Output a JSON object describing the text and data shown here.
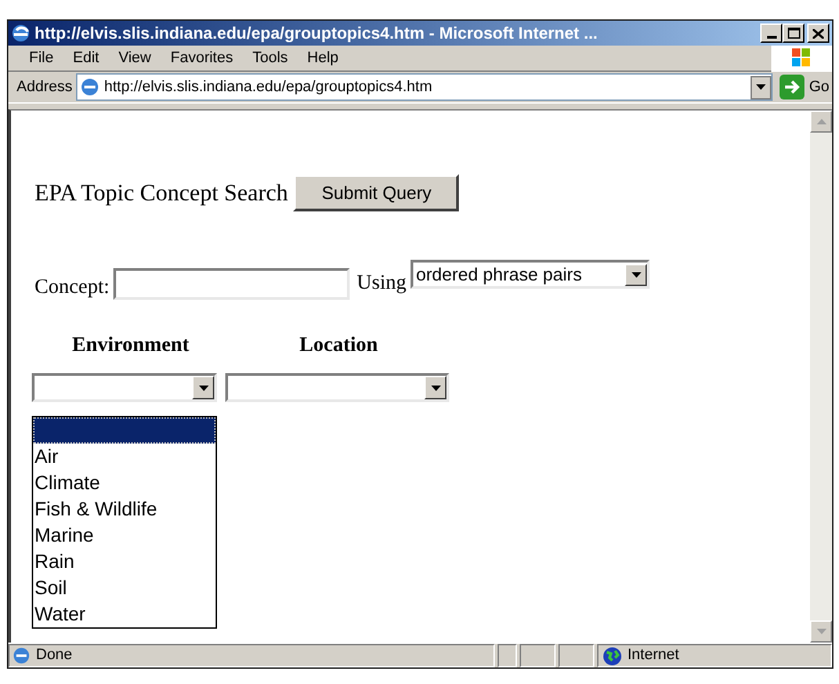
{
  "window": {
    "title": "http://elvis.slis.indiana.edu/epa/grouptopics4.htm - Microsoft Internet ..."
  },
  "menu": [
    "File",
    "Edit",
    "View",
    "Favorites",
    "Tools",
    "Help"
  ],
  "address_bar": {
    "label": "Address",
    "value": "http://elvis.slis.indiana.edu/epa/grouptopics4.htm",
    "go": "Go"
  },
  "page": {
    "heading": "EPA Topic Concept Search",
    "submit": "Submit Query",
    "concept_label": "Concept:",
    "using_label": "Using",
    "using_value": "ordered phrase pairs",
    "columns": [
      "Environment",
      "Location"
    ],
    "environment_options": [
      "Air",
      "Climate",
      "Fish & Wildlife",
      "Marine",
      "Rain",
      "Soil",
      "Water"
    ]
  },
  "status_bar": {
    "text": "Done",
    "zone": "Internet"
  }
}
